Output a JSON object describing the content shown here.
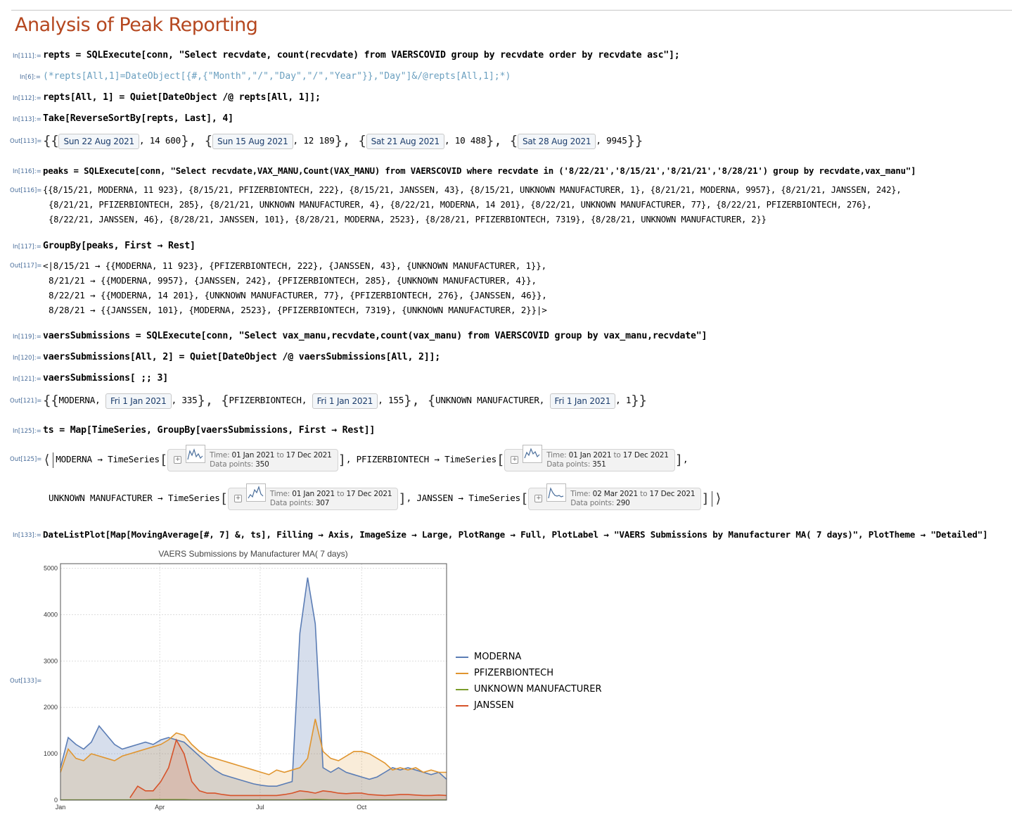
{
  "title": "Analysis of Peak Reporting",
  "cells": {
    "in111": {
      "label": "In[111]:=",
      "code": "repts = SQLExecute[conn, \"Select recvdate, count(recvdate) from VAERSCOVID group by recvdate order by recvdate asc\"];"
    },
    "in6": {
      "label": "In[6]:=",
      "code": "(*repts[All,1]=DateObject[{#,{\"Month\",\"/\",\"Day\",\"/\",\"Year\"}},\"Day\"]&/@repts[All,1];*)"
    },
    "in112": {
      "label": "In[112]:=",
      "code": "repts[All, 1] = Quiet[DateObject /@ repts[All, 1]];"
    },
    "in113": {
      "label": "In[113]:=",
      "code": "Take[ReverseSortBy[repts, Last], 4]"
    },
    "out113": {
      "label": "Out[113]=",
      "dates": [
        "Sun 22 Aug 2021",
        "Sun 15 Aug 2021",
        "Sat 21 Aug 2021",
        "Sat 28 Aug 2021"
      ],
      "counts": [
        "14 600",
        "12 189",
        "10 488",
        "9945"
      ]
    },
    "in116": {
      "label": "In[116]:=",
      "code": "peaks = SQLExecute[conn, \"Select recvdate,VAX_MANU,Count(VAX_MANU) from VAERSCOVID where recvdate in ('8/22/21','8/15/21','8/21/21','8/28/21') group by recvdate,vax_manu\"]"
    },
    "out116": {
      "label": "Out[116]=",
      "lines": [
        "{{8/15/21, MODERNA, 11 923}, {8/15/21, PFIZERBIONTECH, 222}, {8/15/21, JANSSEN, 43}, {8/15/21, UNKNOWN MANUFACTURER, 1}, {8/21/21, MODERNA, 9957}, {8/21/21, JANSSEN, 242},",
        "{8/21/21, PFIZERBIONTECH, 285}, {8/21/21, UNKNOWN MANUFACTURER, 4}, {8/22/21, MODERNA, 14 201}, {8/22/21, UNKNOWN MANUFACTURER, 77}, {8/22/21, PFIZERBIONTECH, 276},",
        "{8/22/21, JANSSEN, 46}, {8/28/21, JANSSEN, 101}, {8/28/21, MODERNA, 2523}, {8/28/21, PFIZERBIONTECH, 7319}, {8/28/21, UNKNOWN MANUFACTURER, 2}}"
      ]
    },
    "in117": {
      "label": "In[117]:=",
      "code": "GroupBy[peaks, First → Rest]"
    },
    "out117": {
      "label": "Out[117]=",
      "lines": [
        "<|8/15/21 → {{MODERNA, 11 923}, {PFIZERBIONTECH, 222}, {JANSSEN, 43}, {UNKNOWN MANUFACTURER, 1}},",
        "8/21/21 → {{MODERNA, 9957}, {JANSSEN, 242}, {PFIZERBIONTECH, 285}, {UNKNOWN MANUFACTURER, 4}},",
        "8/22/21 → {{MODERNA, 14 201}, {UNKNOWN MANUFACTURER, 77}, {PFIZERBIONTECH, 276}, {JANSSEN, 46}},",
        "8/28/21 → {{JANSSEN, 101}, {MODERNA, 2523}, {PFIZERBIONTECH, 7319}, {UNKNOWN MANUFACTURER, 2}}|>"
      ]
    },
    "in119": {
      "label": "In[119]:=",
      "code": "vaersSubmissions = SQLExecute[conn, \"Select vax_manu,recvdate,count(vax_manu) from VAERSCOVID group by vax_manu,recvdate\"]"
    },
    "in120": {
      "label": "In[120]:=",
      "code": "vaersSubmissions[All, 2] = Quiet[DateObject /@ vaersSubmissions[All, 2]];"
    },
    "in121": {
      "label": "In[121]:=",
      "code": "vaersSubmissions[ ;; 3]"
    },
    "out121": {
      "label": "Out[121]=",
      "rows": [
        {
          "name": "MODERNA",
          "date": "Fri 1 Jan 2021",
          "count": "335"
        },
        {
          "name": "PFIZERBIONTECH",
          "date": "Fri 1 Jan 2021",
          "count": "155"
        },
        {
          "name": "UNKNOWN MANUFACTURER",
          "date": "Fri 1 Jan 2021",
          "count": "1"
        }
      ]
    },
    "in125": {
      "label": "In[125]:=",
      "code": "ts = Map[TimeSeries, GroupBy[vaersSubmissions, First → Rest]]"
    },
    "out125": {
      "label": "Out[125]=",
      "series": [
        {
          "name": "MODERNA",
          "fn": "TimeSeries",
          "time_label": "Time:",
          "from": "01 Jan 2021",
          "to_word": "to",
          "to": "17 Dec 2021",
          "points_label": "Data points:",
          "points": "350"
        },
        {
          "name": "PFIZERBIONTECH",
          "fn": "TimeSeries",
          "time_label": "Time:",
          "from": "01 Jan 2021",
          "to_word": "to",
          "to": "17 Dec 2021",
          "points_label": "Data points:",
          "points": "351"
        },
        {
          "name": "UNKNOWN MANUFACTURER",
          "fn": "TimeSeries",
          "time_label": "Time:",
          "from": "01 Jan 2021",
          "to_word": "to",
          "to": "17 Dec 2021",
          "points_label": "Data points:",
          "points": "307"
        },
        {
          "name": "JANSSEN",
          "fn": "TimeSeries",
          "time_label": "Time:",
          "from": "02 Mar 2021",
          "to_word": "to",
          "to": "17 Dec 2021",
          "points_label": "Data points:",
          "points": "290"
        }
      ]
    },
    "in133": {
      "label": "In[133]:=",
      "code": "DateListPlot[Map[MovingAverage[#, 7] &, ts], Filling → Axis, ImageSize → Large, PlotRange → Full, PlotLabel → \"VAERS Submissions by Manufacturer MA( 7 days)\", PlotTheme → \"Detailed\"]"
    },
    "out133": {
      "label": "Out[133]="
    }
  },
  "chart_data": {
    "type": "area",
    "title": "VAERS Submissions by Manufacturer MA( 7 days)",
    "xlabel": "",
    "ylabel": "",
    "x_ticks": [
      "Jan",
      "Apr",
      "Jul",
      "Oct"
    ],
    "y_ticks": [
      "0",
      "1000",
      "2000",
      "3000",
      "4000",
      "5000"
    ],
    "ylim": [
      0,
      5100
    ],
    "grid": true,
    "legend_position": "right",
    "x": [
      "2021-01-01",
      "2021-01-08",
      "2021-01-15",
      "2021-01-22",
      "2021-01-29",
      "2021-02-05",
      "2021-02-12",
      "2021-02-19",
      "2021-02-26",
      "2021-03-05",
      "2021-03-12",
      "2021-03-19",
      "2021-03-26",
      "2021-04-02",
      "2021-04-09",
      "2021-04-16",
      "2021-04-23",
      "2021-04-30",
      "2021-05-07",
      "2021-05-14",
      "2021-05-21",
      "2021-05-28",
      "2021-06-04",
      "2021-06-11",
      "2021-06-18",
      "2021-06-25",
      "2021-07-02",
      "2021-07-09",
      "2021-07-16",
      "2021-07-23",
      "2021-07-30",
      "2021-08-06",
      "2021-08-13",
      "2021-08-20",
      "2021-08-27",
      "2021-09-03",
      "2021-09-10",
      "2021-09-17",
      "2021-09-24",
      "2021-10-01",
      "2021-10-08",
      "2021-10-15",
      "2021-10-22",
      "2021-10-29",
      "2021-11-05",
      "2021-11-12",
      "2021-11-19",
      "2021-11-26",
      "2021-12-03",
      "2021-12-10",
      "2021-12-17"
    ],
    "series": [
      {
        "name": "MODERNA",
        "color": "#5b7db5",
        "fill": "rgba(91,125,181,0.25)",
        "values": [
          700,
          1350,
          1200,
          1100,
          1250,
          1600,
          1400,
          1200,
          1100,
          1150,
          1200,
          1250,
          1200,
          1300,
          1350,
          1300,
          1250,
          1100,
          950,
          800,
          650,
          550,
          500,
          450,
          400,
          350,
          320,
          300,
          300,
          350,
          400,
          3600,
          4800,
          3800,
          700,
          600,
          700,
          600,
          550,
          500,
          450,
          500,
          600,
          700,
          650,
          700,
          650,
          600,
          550,
          600,
          450
        ]
      },
      {
        "name": "PFIZERBIONTECH",
        "color": "#e0952f",
        "fill": "rgba(224,149,47,0.18)",
        "values": [
          600,
          1100,
          900,
          850,
          1000,
          950,
          900,
          850,
          950,
          1000,
          1050,
          1100,
          1150,
          1200,
          1300,
          1450,
          1400,
          1200,
          1050,
          950,
          900,
          850,
          800,
          750,
          700,
          650,
          600,
          550,
          650,
          600,
          650,
          700,
          900,
          1750,
          1050,
          900,
          850,
          950,
          1050,
          1050,
          1000,
          900,
          800,
          650,
          700,
          650,
          700,
          600,
          650,
          600,
          600
        ]
      },
      {
        "name": "UNKNOWN MANUFACTURER",
        "color": "#7a9c2a",
        "fill": "rgba(122,156,42,0.15)",
        "values": [
          5,
          5,
          5,
          5,
          5,
          5,
          5,
          5,
          5,
          5,
          5,
          5,
          10,
          10,
          10,
          10,
          10,
          5,
          5,
          5,
          5,
          5,
          5,
          5,
          5,
          5,
          5,
          5,
          5,
          5,
          5,
          5,
          10,
          15,
          10,
          5,
          5,
          5,
          5,
          5,
          5,
          5,
          5,
          5,
          5,
          5,
          5,
          5,
          5,
          5,
          5
        ]
      },
      {
        "name": "JANSSEN",
        "color": "#d6532a",
        "fill": "rgba(214,83,42,0.15)",
        "values": [
          null,
          null,
          null,
          null,
          null,
          null,
          null,
          null,
          null,
          50,
          300,
          200,
          200,
          400,
          700,
          1300,
          1000,
          400,
          200,
          150,
          150,
          120,
          100,
          100,
          100,
          100,
          100,
          100,
          100,
          120,
          150,
          200,
          180,
          150,
          200,
          180,
          150,
          140,
          150,
          150,
          120,
          110,
          100,
          110,
          120,
          120,
          110,
          100,
          100,
          110,
          100
        ]
      }
    ]
  }
}
